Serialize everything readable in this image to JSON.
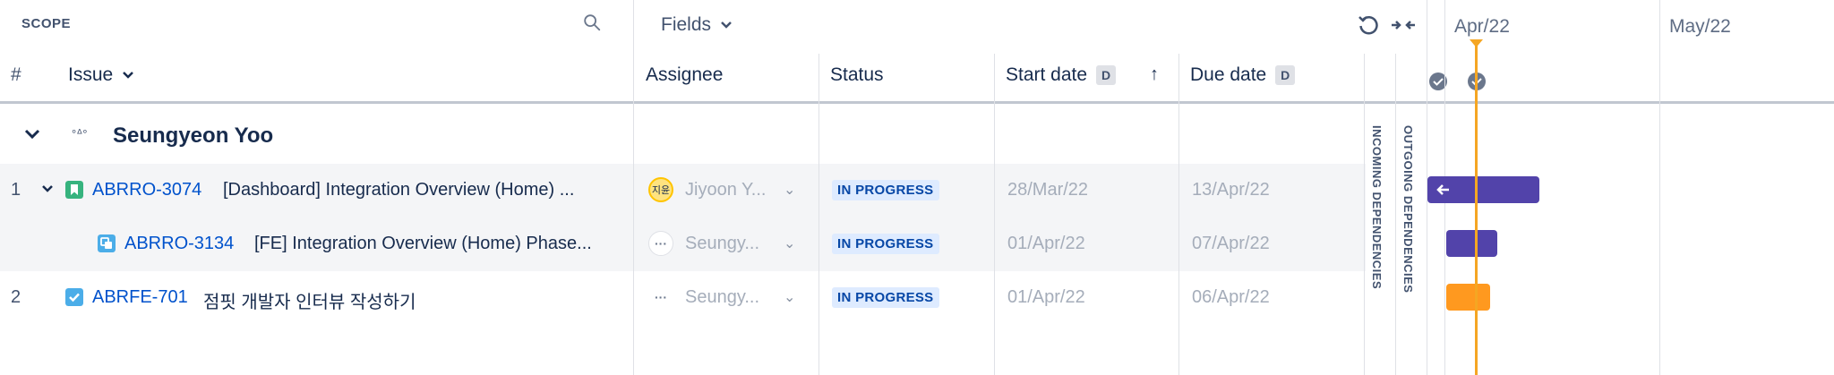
{
  "header": {
    "scope_label": "SCOPE",
    "fields_label": "Fields",
    "hash_label": "#",
    "issue_label": "Issue",
    "assignee_label": "Assignee",
    "status_label": "Status",
    "start_date_label": "Start date",
    "due_date_label": "Due date",
    "date_badge": "D",
    "months": [
      "Apr/22",
      "May/22"
    ]
  },
  "dependencies": {
    "incoming": "INCOMING DEPENDENCIES",
    "outgoing": "OUTGOING DEPENDENCIES"
  },
  "group": {
    "name": "Seungyeon Yoo",
    "avatar_glyph": "°ᐞ°"
  },
  "rows": [
    {
      "num": "1",
      "key": "ABRRO-3074",
      "summary": "[Dashboard] Integration Overview (Home) ...",
      "assignee": "Jiyoon Y...",
      "avatar_text": "지윤",
      "status": "IN PROGRESS",
      "start": "28/Mar/22",
      "due": "13/Apr/22",
      "type": "story",
      "type_color": "#36b37e"
    },
    {
      "num": "",
      "key": "ABRRO-3134",
      "summary": "[FE] Integration Overview (Home) Phase...",
      "assignee": "Seungy...",
      "avatar_text": "···",
      "status": "IN PROGRESS",
      "start": "01/Apr/22",
      "due": "07/Apr/22",
      "type": "subtask",
      "type_color": "#4bade8"
    },
    {
      "num": "2",
      "key": "ABRFE-701",
      "summary": "점핏 개발자 인터뷰 작성하기",
      "assignee": "Seungy...",
      "avatar_text": "···",
      "status": "IN PROGRESS",
      "start": "01/Apr/22",
      "due": "06/Apr/22",
      "type": "task",
      "type_color": "#4bade8"
    }
  ],
  "colors": {
    "bar_purple": "#5243aa",
    "bar_orange": "#ff991f",
    "today_line": "#f5a623",
    "link_blue": "#0052cc",
    "row_highlight": "#f4f5f7"
  }
}
